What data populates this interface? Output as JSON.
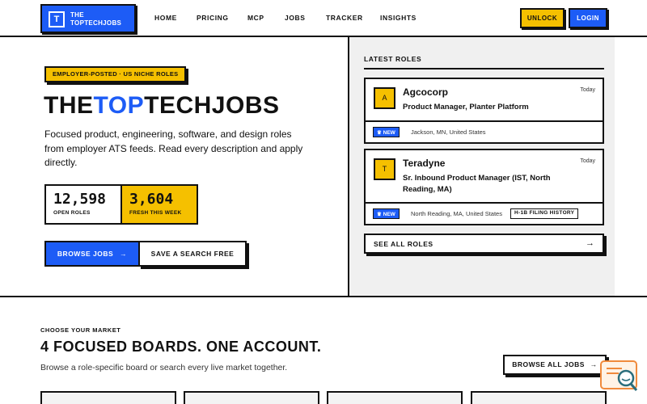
{
  "header": {
    "logo_line1": "THE",
    "logo_line2": "TOPTECHJOBS",
    "logo_mark": "T",
    "nav": [
      "HOME",
      "PRICING",
      "MCP",
      "JOBS",
      "TRACKER",
      "INSIGHTS"
    ],
    "unlock": "UNLOCK",
    "login": "LOGIN"
  },
  "hero": {
    "badge": "EMPLOYER-POSTED · US NICHE ROLES",
    "title_part1": "THE",
    "title_part2": "TOP",
    "title_part3": "TECHJOBS",
    "description": "Focused product, engineering, software, and design roles from employer ATS feeds. Read every description and apply directly.",
    "stats": [
      {
        "value": "12,598",
        "label": "OPEN ROLES"
      },
      {
        "value": "3,604",
        "label": "FRESH THIS WEEK"
      }
    ],
    "browse_button": "BROWSE JOBS",
    "save_button": "SAVE A SEARCH FREE"
  },
  "latest": {
    "title": "LATEST ROLES",
    "jobs": [
      {
        "initial": "A",
        "company": "Agcocorp",
        "date": "Today",
        "role": "Product Manager, Planter Platform",
        "badge": "NEW",
        "location": "Jackson, MN, United States"
      },
      {
        "initial": "T",
        "company": "Teradyne",
        "date": "Today",
        "role": "Sr. Inbound Product Manager (IST, North Reading, MA)",
        "badge": "NEW",
        "location": "North Reading, MA, United States",
        "tag": "H-1B FILING HISTORY"
      }
    ],
    "see_all": "SEE ALL ROLES"
  },
  "markets": {
    "eyebrow": "CHOOSE YOUR MARKET",
    "title": "4 FOCUSED BOARDS. ONE ACCOUNT.",
    "description": "Browse a role-specific board or search every live market together.",
    "browse_all": "BROWSE ALL JOBS"
  },
  "colors": {
    "accent_blue": "#1d5cf6",
    "accent_yellow": "#f5c000",
    "ink": "#111111",
    "panel_gray": "#f0f0f0"
  },
  "icons": [
    "arrow-right-icon",
    "crown-icon",
    "chat-search-icon"
  ]
}
